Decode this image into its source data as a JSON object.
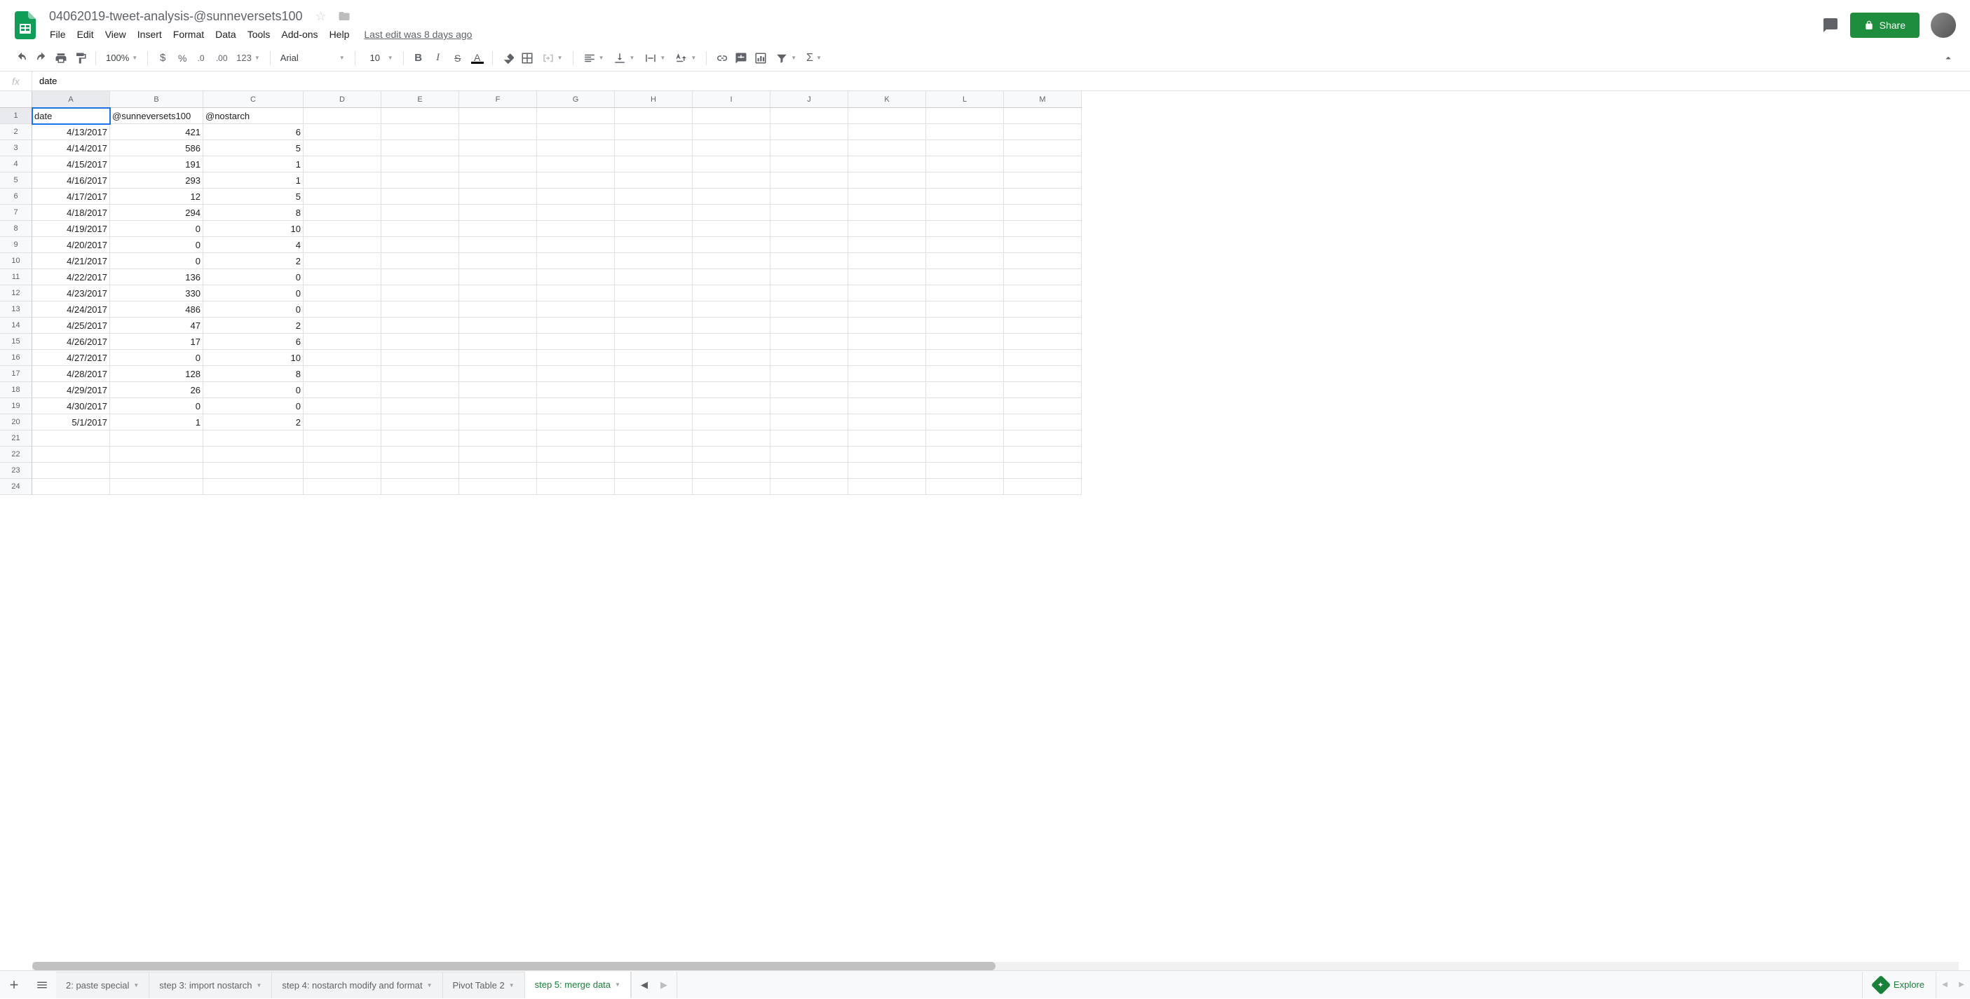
{
  "doc": {
    "title": "04062019-tweet-analysis-@sunneversets100",
    "last_edit": "Last edit was 8 days ago"
  },
  "menus": [
    "File",
    "Edit",
    "View",
    "Insert",
    "Format",
    "Data",
    "Tools",
    "Add-ons",
    "Help"
  ],
  "share_label": "Share",
  "toolbar": {
    "zoom": "100%",
    "font": "Arial",
    "font_size": "10"
  },
  "formula": {
    "value": "date"
  },
  "columns": [
    "A",
    "B",
    "C",
    "D",
    "E",
    "F",
    "G",
    "H",
    "I",
    "J",
    "K",
    "L",
    "M"
  ],
  "active_cell": "A1",
  "rows": [
    {
      "n": 1,
      "a": "date",
      "b": "@sunneversets100",
      "c": "@nostarch",
      "a_align": "left",
      "b_align": "left",
      "c_align": "left"
    },
    {
      "n": 2,
      "a": "4/13/2017",
      "b": "421",
      "c": "6"
    },
    {
      "n": 3,
      "a": "4/14/2017",
      "b": "586",
      "c": "5"
    },
    {
      "n": 4,
      "a": "4/15/2017",
      "b": "191",
      "c": "1"
    },
    {
      "n": 5,
      "a": "4/16/2017",
      "b": "293",
      "c": "1"
    },
    {
      "n": 6,
      "a": "4/17/2017",
      "b": "12",
      "c": "5"
    },
    {
      "n": 7,
      "a": "4/18/2017",
      "b": "294",
      "c": "8"
    },
    {
      "n": 8,
      "a": "4/19/2017",
      "b": "0",
      "c": "10"
    },
    {
      "n": 9,
      "a": "4/20/2017",
      "b": "0",
      "c": "4"
    },
    {
      "n": 10,
      "a": "4/21/2017",
      "b": "0",
      "c": "2"
    },
    {
      "n": 11,
      "a": "4/22/2017",
      "b": "136",
      "c": "0"
    },
    {
      "n": 12,
      "a": "4/23/2017",
      "b": "330",
      "c": "0"
    },
    {
      "n": 13,
      "a": "4/24/2017",
      "b": "486",
      "c": "0"
    },
    {
      "n": 14,
      "a": "4/25/2017",
      "b": "47",
      "c": "2"
    },
    {
      "n": 15,
      "a": "4/26/2017",
      "b": "17",
      "c": "6"
    },
    {
      "n": 16,
      "a": "4/27/2017",
      "b": "0",
      "c": "10"
    },
    {
      "n": 17,
      "a": "4/28/2017",
      "b": "128",
      "c": "8"
    },
    {
      "n": 18,
      "a": "4/29/2017",
      "b": "26",
      "c": "0"
    },
    {
      "n": 19,
      "a": "4/30/2017",
      "b": "0",
      "c": "0"
    },
    {
      "n": 20,
      "a": "5/1/2017",
      "b": "1",
      "c": "2"
    },
    {
      "n": 21,
      "a": "",
      "b": "",
      "c": ""
    },
    {
      "n": 22,
      "a": "",
      "b": "",
      "c": ""
    },
    {
      "n": 23,
      "a": "",
      "b": "",
      "c": ""
    },
    {
      "n": 24,
      "a": "",
      "b": "",
      "c": ""
    }
  ],
  "sheets": [
    {
      "label": "2: paste special",
      "active": false
    },
    {
      "label": "step 3: import nostarch",
      "active": false
    },
    {
      "label": "step 4: nostarch modify and format",
      "active": false
    },
    {
      "label": "Pivot Table 2",
      "active": false
    },
    {
      "label": "step 5: merge data",
      "active": true
    }
  ],
  "explore_label": "Explore"
}
